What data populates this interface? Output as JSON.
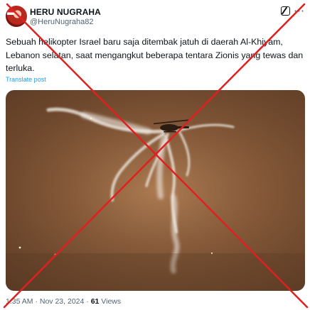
{
  "author": {
    "name": "HERU NUGRAHA",
    "handle": "@HeruNugraha82"
  },
  "icons": {
    "avatar": "user-avatar",
    "grok": "grok-icon",
    "more": "more-icon"
  },
  "post": {
    "text": "Sebuah helikopter Israel baru saja ditembak jatuh di daerah Al-Khiyam, Lebanon selatan, saat mengangkut beberapa tentara Zionis yang tewas dan terluka.",
    "translate_label": "Translate post"
  },
  "meta": {
    "time": "1:35 AM",
    "separator": "·",
    "date": "Nov 23, 2024",
    "views_count": "61",
    "views_label": "Views"
  },
  "overlay": {
    "type": "red-cross-mark",
    "color": "#e02020"
  },
  "colors": {
    "text": "#0f1419",
    "secondary": "#536471",
    "link": "#1d9bf0"
  }
}
